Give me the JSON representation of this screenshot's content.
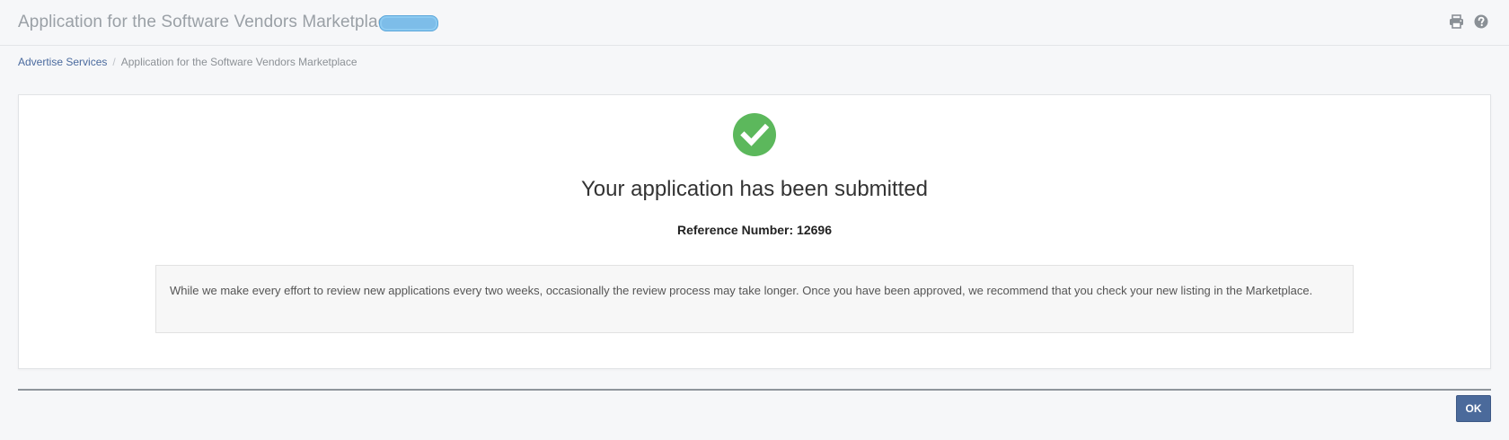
{
  "header": {
    "title": "Application for the Software Vendors Marketplace",
    "status_color": "#7dbde9",
    "icons": [
      "print-icon",
      "help-icon"
    ]
  },
  "breadcrumb": {
    "items": [
      {
        "label": "Advertise Services"
      },
      {
        "label": "Application for the Software Vendors Marketplace"
      }
    ],
    "separator": "/"
  },
  "confirmation": {
    "icon": "check-circle-icon",
    "icon_color": "#5cb85c",
    "title": "Your application has been submitted",
    "reference_label": "Reference Number:",
    "reference_number": "12696",
    "message": "While we make every effort to review new applications every two weeks, occasionally the review process may take longer. Once you have been approved, we recommend that you check your new listing in the Marketplace."
  },
  "footer": {
    "ok_label": "OK",
    "button_color": "#4b6a9b"
  }
}
